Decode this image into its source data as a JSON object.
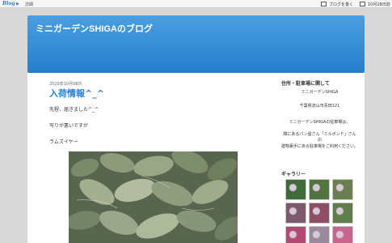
{
  "topbar": {
    "logo": "Blog",
    "mark": "▶",
    "back_link": "詳細",
    "write_label": "ブログを書く",
    "reading_label": "10月18日前"
  },
  "blog": {
    "title": "ミニガーデンSHIGAのブログ"
  },
  "post": {
    "date": "2020年10月08日",
    "title": "入荷情報^_^",
    "lines": [
      "先程、届きました^_^",
      "写りが悪いですが",
      "ラムズイヤー"
    ]
  },
  "sidebar": {
    "about_heading": "住所・駐車場に関して",
    "about_name": "ミニガーデンSHIGA",
    "about_address": "千葉県流山市青田121",
    "about_desc": "ミニガーデンSHIGAの駐車場は、",
    "about_desc2": "隣にあるパン屋さん「ミルポンド」さんの",
    "about_desc3": "建物裏手にある駐車場をご利用ください。",
    "gallery_heading": "ギャラリー",
    "gallery_colors": [
      "#3f6b3a",
      "#52743f",
      "#6a7f4e",
      "#7a5a6c",
      "#8e4f63",
      "#5f7e4c",
      "#b24a73",
      "#9a8a9e",
      "#c9648f"
    ]
  },
  "colors": {
    "accent": "#2a7fd1",
    "header_top": "#4a9fe0",
    "header_bottom": "#257fcf"
  },
  "icons": {
    "write": "pencil-icon"
  }
}
